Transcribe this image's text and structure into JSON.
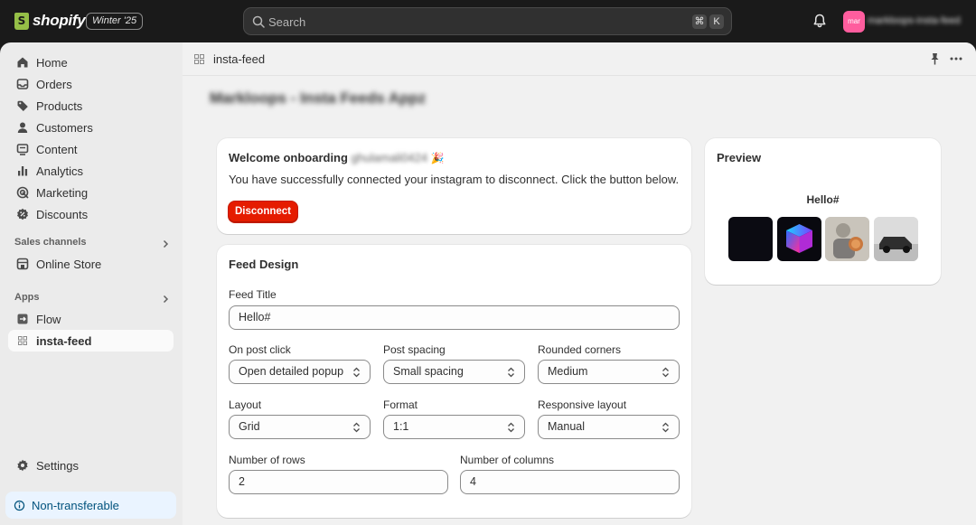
{
  "topbar": {
    "brand": "shopify",
    "edition_badge": "Winter '25",
    "search_placeholder": "Search",
    "shortcut_keys": [
      "⌘",
      "K"
    ],
    "avatar_initials": "mar",
    "store_name": "markloops-insta-feed"
  },
  "sidebar": {
    "items": [
      {
        "label": "Home",
        "icon": "home-icon"
      },
      {
        "label": "Orders",
        "icon": "orders-icon"
      },
      {
        "label": "Products",
        "icon": "tag-icon"
      },
      {
        "label": "Customers",
        "icon": "person-icon"
      },
      {
        "label": "Content",
        "icon": "content-icon"
      },
      {
        "label": "Analytics",
        "icon": "bar-chart-icon"
      },
      {
        "label": "Marketing",
        "icon": "target-icon"
      },
      {
        "label": "Discounts",
        "icon": "discount-icon"
      }
    ],
    "sales_channels_label": "Sales channels",
    "online_store_label": "Online Store",
    "apps_label": "Apps",
    "flow_label": "Flow",
    "insta_feed_label": "insta-feed",
    "settings_label": "Settings",
    "non_transferable_label": "Non-transferable"
  },
  "app": {
    "header_title": "insta-feed",
    "page_title": "Markloops - Insta Feeds Appz"
  },
  "welcome": {
    "heading": "Welcome onboarding",
    "username": "ghulamali0424",
    "emoji": "🎉",
    "message": "You have successfully connected your instagram to disconnect. Click the button below.",
    "disconnect_label": "Disconnect"
  },
  "feed_design": {
    "heading": "Feed Design",
    "feed_title_label": "Feed Title",
    "feed_title_value": "Hello#",
    "on_post_click_label": "On post click",
    "on_post_click_value": "Open detailed popup",
    "post_spacing_label": "Post spacing",
    "post_spacing_value": "Small spacing",
    "rounded_corners_label": "Rounded corners",
    "rounded_corners_value": "Medium",
    "layout_label": "Layout",
    "layout_value": "Grid",
    "format_label": "Format",
    "format_value": "1:1",
    "responsive_layout_label": "Responsive layout",
    "responsive_layout_value": "Manual",
    "rows_label": "Number of rows",
    "rows_value": "2",
    "columns_label": "Number of columns",
    "columns_value": "4"
  },
  "preview": {
    "heading": "Preview",
    "feed_title": "Hello#",
    "thumbnails": [
      "dark-post-image",
      "neon-cube-image",
      "illustration-image",
      "car-image"
    ]
  },
  "colors": {
    "accent_red": "#e51c00",
    "topbar": "#1a1a1a",
    "avatar": "#ff5d9e",
    "info_bg": "#eaf4ff"
  }
}
